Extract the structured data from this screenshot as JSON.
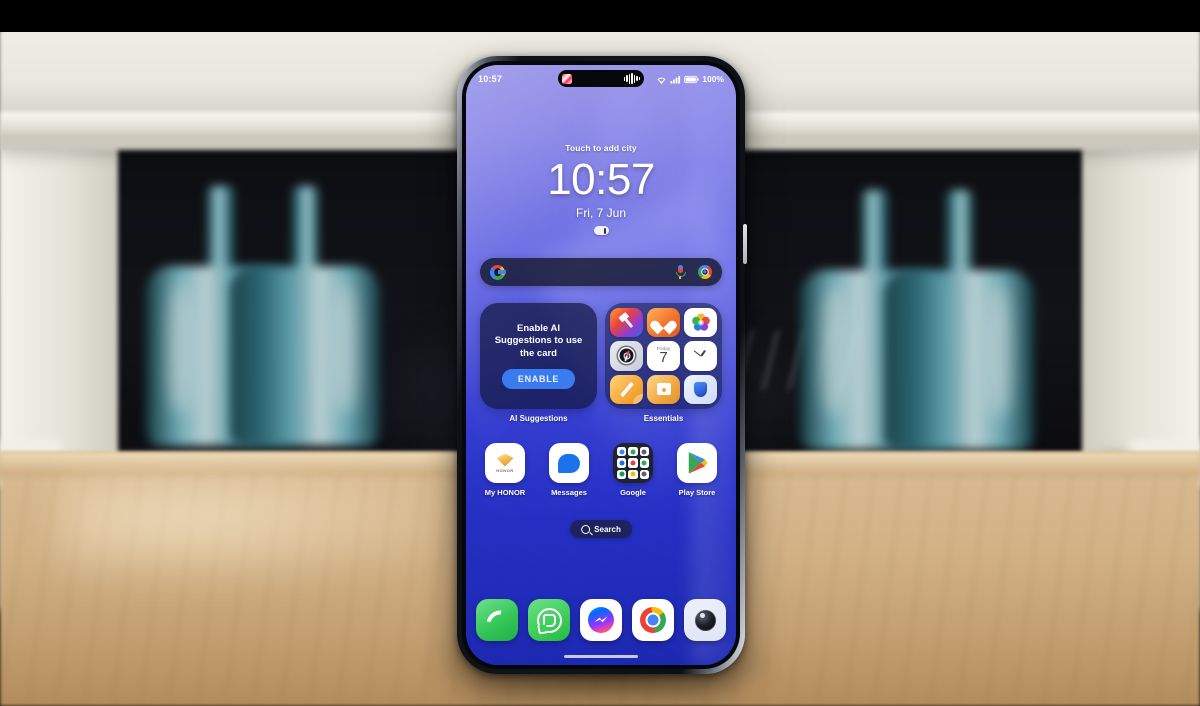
{
  "scene": {
    "description": "Smartphone home screen on wooden table in front of fireplace",
    "device": "HONOR phone",
    "background_elements": [
      "fireplace-mantel",
      "glass-bottles",
      "wooden-table"
    ]
  },
  "status_bar": {
    "time": "10:57",
    "battery_percent": "100%",
    "icons": [
      "wifi-icon",
      "signal-icon",
      "battery-icon"
    ],
    "island_icons": [
      "app-activity-icon",
      "audio-waveform-icon"
    ]
  },
  "clock_widget": {
    "city_prompt": "Touch to add city",
    "time": "10:57",
    "date": "Fri, 7 Jun",
    "weather_icon": "weather-pill-icon"
  },
  "search": {
    "placeholder": "",
    "logo": "google-g-icon",
    "mic": "microphone-icon",
    "lens": "google-lens-icon"
  },
  "widgets": [
    {
      "name": "ai-suggestions",
      "label": "AI Suggestions",
      "body_text": "Enable AI Suggestions to use the card",
      "button_label": "ENABLE"
    },
    {
      "name": "essentials",
      "label": "Essentials",
      "icons": [
        {
          "name": "themes-icon",
          "label": "Themes"
        },
        {
          "name": "health-icon",
          "label": "Health"
        },
        {
          "name": "gallery-icon",
          "label": "Gallery"
        },
        {
          "name": "compass-icon",
          "label": "Compass"
        },
        {
          "name": "calendar-icon",
          "label": "Calendar",
          "day_of_week": "Friday",
          "day_number": "7"
        },
        {
          "name": "clock-icon",
          "label": "Clock"
        },
        {
          "name": "notes-icon",
          "label": "Notes"
        },
        {
          "name": "files-icon",
          "label": "Files"
        },
        {
          "name": "security-icon",
          "label": "Phone Manager"
        }
      ]
    }
  ],
  "apps": [
    {
      "name": "my-honor",
      "label": "My HONOR",
      "icon": "honor-gem-icon",
      "badge_text": "HONOR"
    },
    {
      "name": "messages",
      "label": "Messages",
      "icon": "message-bubble-icon"
    },
    {
      "name": "google-folder",
      "label": "Google",
      "icon": "google-folder-icon"
    },
    {
      "name": "play-store",
      "label": "Play Store",
      "icon": "play-store-icon"
    }
  ],
  "search_pill": {
    "label": "Search",
    "icon": "magnifier-icon"
  },
  "dock": [
    {
      "name": "phone",
      "label": "Phone",
      "icon": "phone-handset-icon"
    },
    {
      "name": "whatsapp",
      "label": "WhatsApp",
      "icon": "whatsapp-icon"
    },
    {
      "name": "messenger",
      "label": "Messenger",
      "icon": "messenger-bolt-icon"
    },
    {
      "name": "chrome",
      "label": "Chrome",
      "icon": "chrome-icon"
    },
    {
      "name": "camera",
      "label": "Camera",
      "icon": "camera-lens-icon"
    }
  ],
  "colors": {
    "wallpaper_top": "#8a84e0",
    "wallpaper_bottom": "#2230c9",
    "accent_button": "#3b7bf0",
    "card_bg": "#121840",
    "table": "#d2b185"
  }
}
